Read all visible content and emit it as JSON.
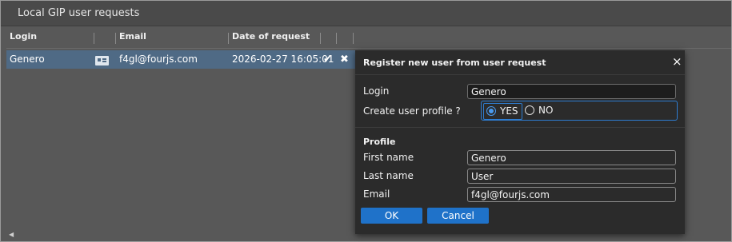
{
  "panel": {
    "title": "Local GIP user requests"
  },
  "table": {
    "columns": [
      "Login",
      "Email",
      "Date of request"
    ],
    "rows": [
      {
        "login": "Genero",
        "email": "f4gl@fourjs.com",
        "date": "2026-02-27 16:05:01",
        "accept_icon": "✔",
        "reject_icon": "✖"
      }
    ]
  },
  "dialog": {
    "title": "Register new user from user request",
    "close": "×",
    "login_label": "Login",
    "login_value": "Genero",
    "create_profile_label": "Create user profile ?",
    "radio_yes": "YES",
    "radio_no": "NO",
    "selected": "YES",
    "profile_title": "Profile",
    "first_name_label": "First name",
    "first_name_value": "Genero",
    "last_name_label": "Last name",
    "last_name_value": "User",
    "email_label": "Email",
    "email_value": "f4gl@fourjs.com",
    "ok": "OK",
    "cancel": "Cancel"
  },
  "icons": {
    "scroll_left": "◀"
  },
  "colors": {
    "selection": "#4f6a85",
    "accent": "#1f72c9",
    "focus": "#2e7dd1"
  }
}
